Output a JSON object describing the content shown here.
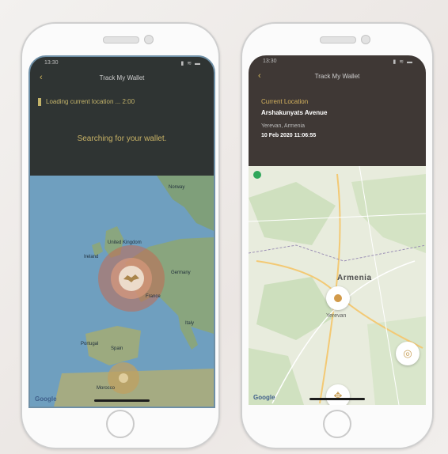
{
  "left_screen": {
    "status_time": "13:30",
    "status_icons": "▮ ≋ ▬",
    "header": {
      "back_icon": "chevron-left-icon",
      "title": "Track My Wallet"
    },
    "loading_text": "Loading current location ... 2:00",
    "searching_text": "Searching for your wallet.",
    "map": {
      "labels": [
        "Norway",
        "United Kingdom",
        "Ireland",
        "Germany",
        "France",
        "Portugal",
        "Spain",
        "Morocco",
        "Italy"
      ],
      "attribution": "Google"
    }
  },
  "right_screen": {
    "status_time": "13:30",
    "status_icons": "▮ ≋ ▬",
    "header": {
      "back_icon": "chevron-left-icon",
      "title": "Track My Wallet"
    },
    "current_location_label": "Current Location",
    "street": "Arshakunyats Avenue",
    "city": "Yerevan, Armenia",
    "datetime": "10 Feb 2020   11:06:55",
    "map": {
      "country_label": "Armenia",
      "city_label": "Yerevan",
      "attribution": "Google"
    }
  },
  "colors": {
    "accent_gold": "#d2b65c",
    "dark_header": "#2f3433",
    "map_water": "#6f9fbf"
  }
}
